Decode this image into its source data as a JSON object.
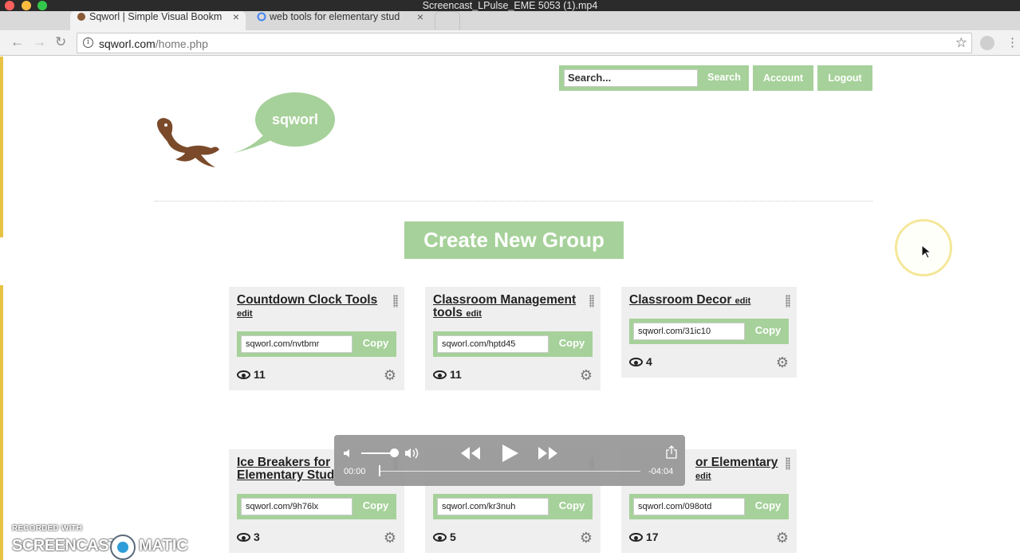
{
  "window": {
    "title": "Screencast_LPulse_EME 5053 (1).mp4"
  },
  "tabs": [
    {
      "label": "Sqworl | Simple Visual Bookm",
      "close": "×"
    },
    {
      "label": "web tools for elementary stud",
      "close": "×"
    }
  ],
  "address": {
    "host": "sqworl.com",
    "path": "/home.php"
  },
  "header": {
    "search_placeholder": "Search...",
    "search_label": "Search",
    "account_label": "Account",
    "logout_label": "Logout"
  },
  "logo": {
    "text": "sqworl"
  },
  "create_group_label": "Create New Group",
  "edit_label": "edit",
  "copy_label": "Copy",
  "groups": [
    {
      "title": "Countdown Clock Tools",
      "url": "sqworl.com/nvtbmr",
      "views": "11"
    },
    {
      "title": "Classroom Management tools",
      "url": "sqworl.com/hptd45",
      "views": "11"
    },
    {
      "title": "Classroom Decor",
      "url": "sqworl.com/31ic10",
      "views": "4"
    },
    {
      "title": "Ice Breakers for Elementary Stud",
      "url": "sqworl.com/9h76lx",
      "views": "3"
    },
    {
      "title": "",
      "url": "sqworl.com/kr3nuh",
      "views": "5"
    },
    {
      "title": "or Elementary",
      "url": "sqworl.com/098otd",
      "views": "17"
    }
  ],
  "player": {
    "elapsed": "00:00",
    "remaining": "-04:04"
  },
  "watermark": {
    "small": "RECORDED WITH",
    "big_left": "SCREENCAST",
    "big_right": "MATIC"
  },
  "colors": {
    "accent_green": "#a6d19a",
    "logo_brown": "#7a4a2a"
  }
}
